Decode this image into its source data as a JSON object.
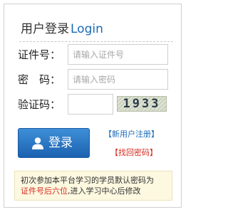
{
  "title": {
    "zh": "用户登录",
    "en": "Login"
  },
  "fields": {
    "id": {
      "label": "证件号：",
      "placeholder": "请输入证件号",
      "value": ""
    },
    "password": {
      "label": "密　码：",
      "placeholder": "请输入密码",
      "value": ""
    },
    "captcha": {
      "label": "验证码：",
      "value": "",
      "image_text": "1933"
    }
  },
  "buttons": {
    "login": "登录"
  },
  "links": {
    "register": "【新用户注册】",
    "recover": "【找回密码】"
  },
  "notice": {
    "line1": "初次参加本平台学习的学员默认密码为",
    "highlight": "证件号后六位",
    "line2": ",进入学习中心后修改"
  },
  "colors": {
    "accent": "#1a6bb8",
    "warning": "#d42a1e",
    "notice_bg": "#fdf8e0"
  }
}
